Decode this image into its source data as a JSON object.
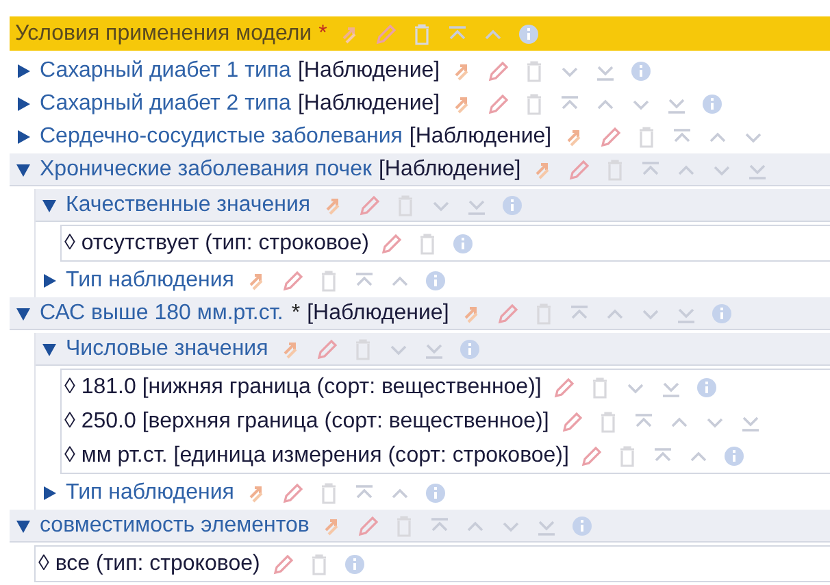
{
  "header": {
    "title": "Условия применения модели",
    "marker": "*",
    "actions": [
      {
        "kind": "copy"
      },
      {
        "kind": "edit"
      },
      {
        "kind": "delete"
      },
      {
        "kind": "top"
      },
      {
        "kind": "up"
      },
      {
        "kind": "info"
      }
    ]
  },
  "tree": [
    {
      "kind": "node",
      "name": "Сахарный диабет 1 типа",
      "type": "[Наблюдение]",
      "expanded": false,
      "actions": [
        {
          "kind": "copy"
        },
        {
          "kind": "edit"
        },
        {
          "kind": "delete"
        },
        {
          "kind": "down"
        },
        {
          "kind": "bottom"
        },
        {
          "kind": "info"
        }
      ]
    },
    {
      "kind": "node",
      "name": "Сахарный диабет 2 типа",
      "type": "[Наблюдение]",
      "expanded": false,
      "actions": [
        {
          "kind": "copy"
        },
        {
          "kind": "edit"
        },
        {
          "kind": "delete"
        },
        {
          "kind": "top"
        },
        {
          "kind": "up"
        },
        {
          "kind": "down"
        },
        {
          "kind": "bottom"
        },
        {
          "kind": "info"
        }
      ]
    },
    {
      "kind": "node",
      "name": "Сердечно-сосудистые заболевания",
      "type": "[Наблюдение]",
      "expanded": false,
      "actions": [
        {
          "kind": "copy"
        },
        {
          "kind": "edit"
        },
        {
          "kind": "delete"
        },
        {
          "kind": "top"
        },
        {
          "kind": "up"
        },
        {
          "kind": "down"
        }
      ]
    },
    {
      "kind": "node",
      "name": "Хронические заболевания почек",
      "type": "[Наблюдение]",
      "expanded": true,
      "actions": [
        {
          "kind": "copy"
        },
        {
          "kind": "edit"
        },
        {
          "kind": "delete"
        },
        {
          "kind": "top"
        },
        {
          "kind": "up"
        },
        {
          "kind": "down"
        },
        {
          "kind": "bottom"
        }
      ],
      "children": [
        {
          "kind": "node",
          "name": "Качественные значения",
          "expanded": true,
          "actions": [
            {
              "kind": "copy"
            },
            {
              "kind": "edit"
            },
            {
              "kind": "delete"
            },
            {
              "kind": "down"
            },
            {
              "kind": "bottom"
            },
            {
              "kind": "info"
            }
          ],
          "children": [
            {
              "kind": "value",
              "text": "◊ отсутствует (тип: строковое)",
              "actions": [
                {
                  "kind": "edit"
                },
                {
                  "kind": "delete"
                },
                {
                  "kind": "info"
                }
              ]
            }
          ]
        },
        {
          "kind": "node",
          "name": "Тип наблюдения",
          "expanded": false,
          "actions": [
            {
              "kind": "copy"
            },
            {
              "kind": "edit"
            },
            {
              "kind": "delete"
            },
            {
              "kind": "top"
            },
            {
              "kind": "up"
            },
            {
              "kind": "info"
            }
          ]
        }
      ]
    },
    {
      "kind": "node",
      "name": "САС выше 180 мм.рт.ст.",
      "marker": "*",
      "type": "[Наблюдение]",
      "expanded": true,
      "actions": [
        {
          "kind": "copy"
        },
        {
          "kind": "edit"
        },
        {
          "kind": "delete"
        },
        {
          "kind": "top"
        },
        {
          "kind": "up"
        },
        {
          "kind": "down"
        },
        {
          "kind": "bottom"
        },
        {
          "kind": "info"
        }
      ],
      "children": [
        {
          "kind": "node",
          "name": "Числовые значения",
          "expanded": true,
          "actions": [
            {
              "kind": "copy"
            },
            {
              "kind": "edit"
            },
            {
              "kind": "delete"
            },
            {
              "kind": "down"
            },
            {
              "kind": "bottom"
            },
            {
              "kind": "info"
            }
          ],
          "children": [
            {
              "kind": "value",
              "text": "◊ 181.0 [нижняя граница (сорт: вещественное)]",
              "actions": [
                {
                  "kind": "edit"
                },
                {
                  "kind": "delete"
                },
                {
                  "kind": "down"
                },
                {
                  "kind": "bottom"
                },
                {
                  "kind": "info"
                }
              ]
            },
            {
              "kind": "value",
              "text": "◊ 250.0 [верхняя граница (сорт: вещественное)]",
              "actions": [
                {
                  "kind": "edit"
                },
                {
                  "kind": "delete"
                },
                {
                  "kind": "top"
                },
                {
                  "kind": "up"
                },
                {
                  "kind": "down"
                },
                {
                  "kind": "bottom"
                }
              ]
            },
            {
              "kind": "value",
              "text": "◊ мм рт.ст. [единица измерения (сорт: строковое)]",
              "actions": [
                {
                  "kind": "edit"
                },
                {
                  "kind": "delete"
                },
                {
                  "kind": "top"
                },
                {
                  "kind": "up"
                },
                {
                  "kind": "info"
                }
              ]
            }
          ]
        },
        {
          "kind": "node",
          "name": "Тип наблюдения",
          "expanded": false,
          "actions": [
            {
              "kind": "copy"
            },
            {
              "kind": "edit"
            },
            {
              "kind": "delete"
            },
            {
              "kind": "top"
            },
            {
              "kind": "up"
            },
            {
              "kind": "info"
            }
          ]
        }
      ]
    },
    {
      "kind": "node",
      "name": "совместимость элементов",
      "expanded": true,
      "actions": [
        {
          "kind": "copy"
        },
        {
          "kind": "edit"
        },
        {
          "kind": "delete"
        },
        {
          "kind": "top"
        },
        {
          "kind": "up"
        },
        {
          "kind": "down"
        },
        {
          "kind": "bottom"
        },
        {
          "kind": "info"
        }
      ],
      "children": [
        {
          "kind": "value",
          "text": "◊ все (тип: строковое)",
          "actions": [
            {
              "kind": "edit"
            },
            {
              "kind": "delete"
            },
            {
              "kind": "info"
            }
          ]
        }
      ]
    }
  ]
}
